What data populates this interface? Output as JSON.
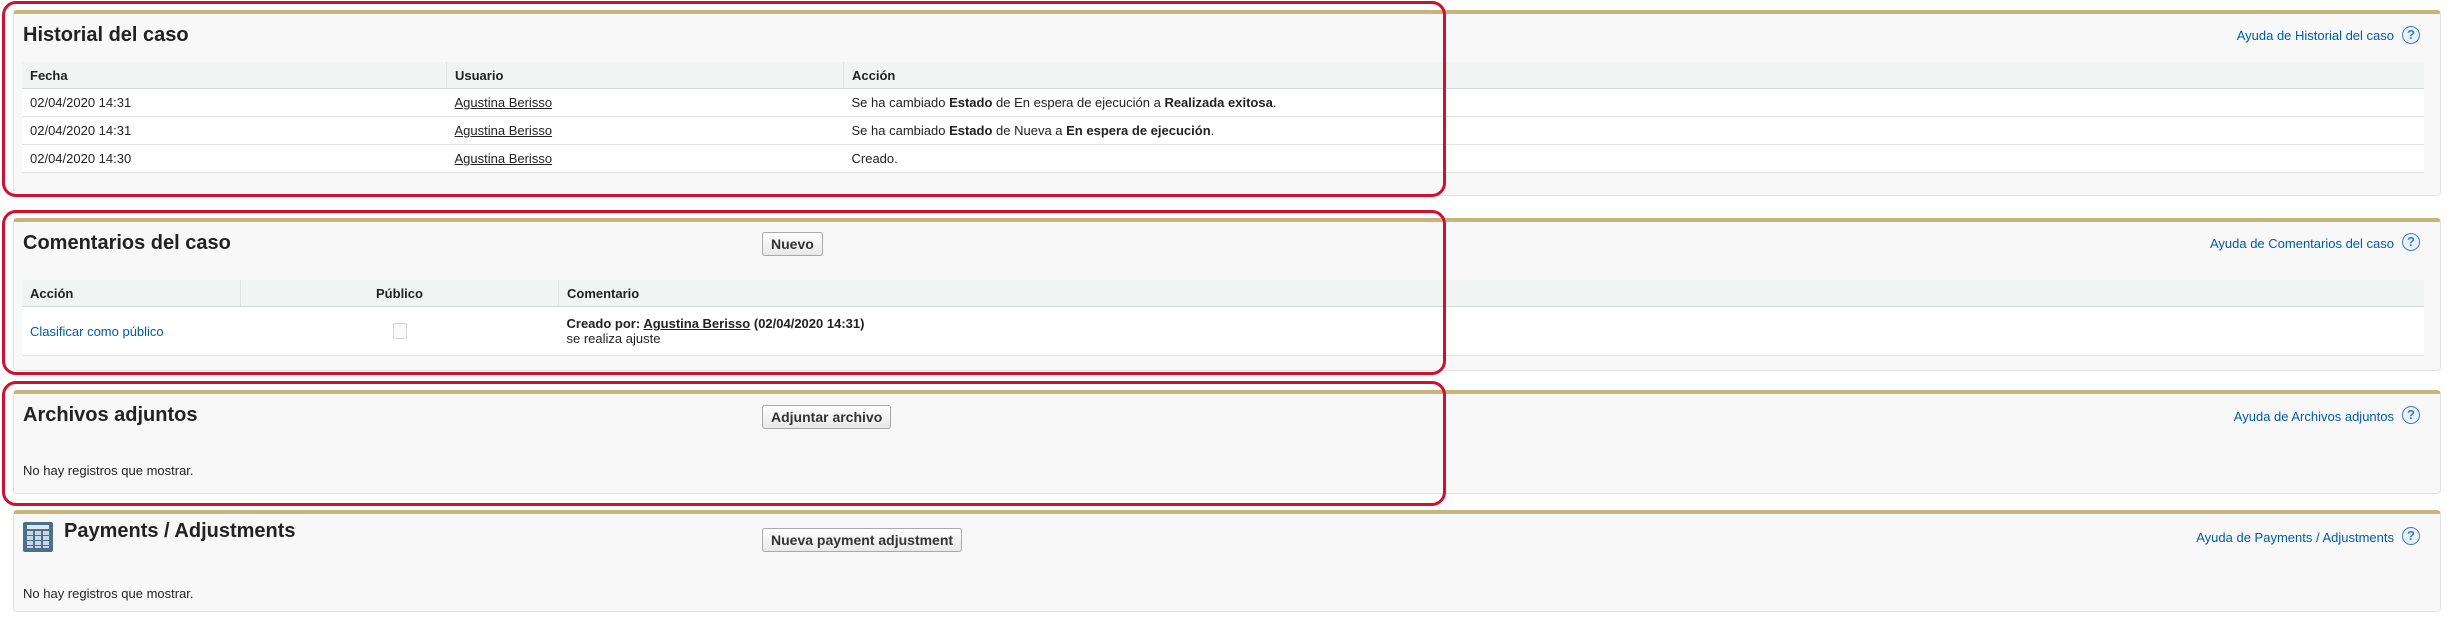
{
  "case_history": {
    "title": "Historial del caso",
    "help_label": "Ayuda de Historial del caso",
    "columns": [
      "Fecha",
      "Usuario",
      "Acción"
    ],
    "rows": [
      {
        "date": "02/04/2020 14:31",
        "user": "Agustina Berisso",
        "action_pre": "Se ha cambiado ",
        "field": "Estado",
        "action_mid": " de En espera de ejecución a ",
        "new_value": "Realizada exitosa",
        "action_post": "."
      },
      {
        "date": "02/04/2020 14:31",
        "user": "Agustina Berisso",
        "action_pre": "Se ha cambiado ",
        "field": "Estado",
        "action_mid": " de Nueva a ",
        "new_value": "En espera de ejecución",
        "action_post": "."
      },
      {
        "date": "02/04/2020 14:30",
        "user": "Agustina Berisso",
        "action_pre": "Creado.",
        "field": "",
        "action_mid": "",
        "new_value": "",
        "action_post": ""
      }
    ]
  },
  "case_comments": {
    "title": "Comentarios del caso",
    "new_button": "Nuevo",
    "help_label": "Ayuda de Comentarios del caso",
    "columns": [
      "Acción",
      "Público",
      "Comentario"
    ],
    "rows": [
      {
        "action_link": "Clasificar como público",
        "public_checked": false,
        "created_by_label": "Creado por:",
        "author": "Agustina Berisso",
        "created_at": "(02/04/2020 14:31)",
        "text": "se realiza ajuste"
      }
    ]
  },
  "attachments": {
    "title": "Archivos adjuntos",
    "attach_button": "Adjuntar archivo",
    "help_label": "Ayuda de Archivos adjuntos",
    "empty_text": "No hay registros que mostrar."
  },
  "payments": {
    "title": "Payments / Adjustments",
    "new_button": "Nueva payment adjustment",
    "help_label": "Ayuda de Payments / Adjustments",
    "empty_text": "No hay registros que mostrar.",
    "icon": "table-icon"
  },
  "help_icon_glyph": "?",
  "colors": {
    "header_accent": "#c5b47c",
    "link_blue": "#015ba7",
    "highlight_red": "#d0102c",
    "panel_bg": "#f8f8f8"
  }
}
